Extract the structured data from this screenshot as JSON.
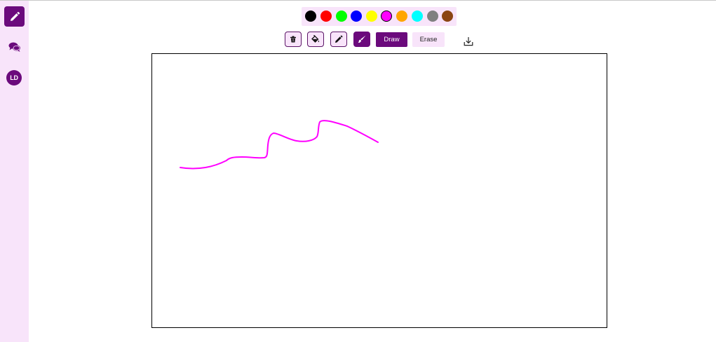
{
  "sidebar": {
    "items": [
      {
        "name": "draw",
        "icon": "pencil-icon",
        "active": true
      },
      {
        "name": "chat",
        "icon": "chat-bubbles-icon",
        "active": false
      }
    ],
    "avatar_initials": "LD"
  },
  "palette": {
    "colors": [
      "#000000",
      "#ff0000",
      "#00ff00",
      "#0000ff",
      "#ffff00",
      "#ff00ff",
      "#ffa500",
      "#00ffff",
      "#808080",
      "#8b4513"
    ],
    "selected": "#ff00ff"
  },
  "toolbar": {
    "tools": [
      {
        "name": "clear",
        "icon": "trash-icon",
        "active": false
      },
      {
        "name": "fill",
        "icon": "paint-bucket-icon",
        "active": false
      },
      {
        "name": "pencil",
        "icon": "pencil-icon",
        "active": false
      },
      {
        "name": "brush",
        "icon": "brush-icon",
        "active": true
      }
    ],
    "draw_label": "Draw",
    "erase_label": "Erase",
    "download_icon": "download-icon"
  },
  "canvas": {
    "stroke_color": "#ff00ff"
  },
  "theme": {
    "accent": "#6b0a7c",
    "sidebar_bg": "#f8e4fa"
  }
}
